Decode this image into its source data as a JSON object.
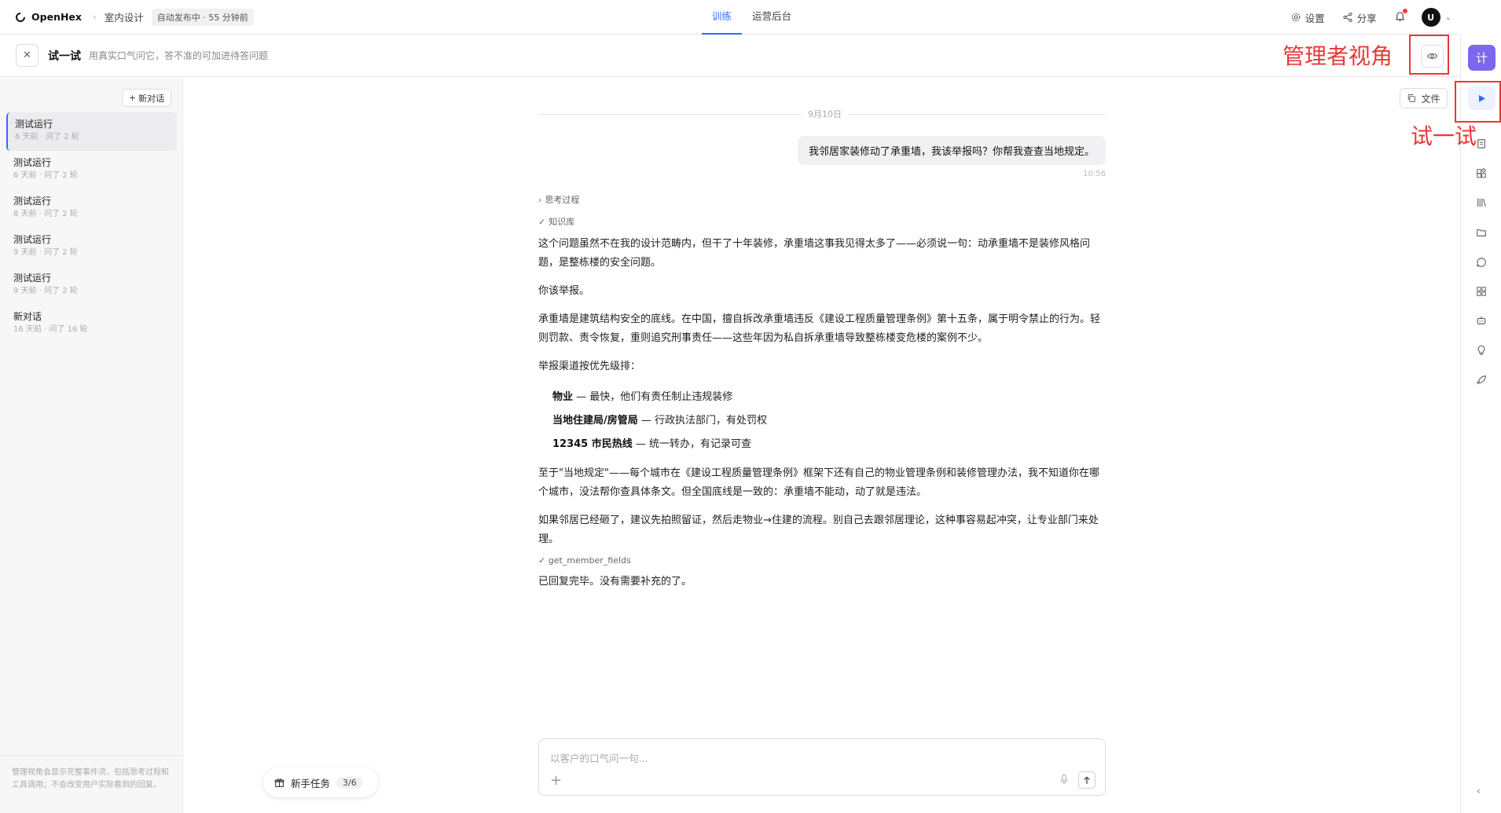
{
  "topbar": {
    "brand": "OpenHex",
    "crumb": "室内设计",
    "status": "自动发布中 · 55 分钟前",
    "tabs": [
      {
        "label": "训练",
        "active": true
      },
      {
        "label": "运营后台",
        "active": false
      }
    ],
    "settings_label": "设置",
    "share_label": "分享",
    "avatar_initial": "U"
  },
  "subbar": {
    "title": "试一试",
    "description": "用真实口气问它，答不准的可加进待答问题",
    "admin_annotation": "管理者视角"
  },
  "sidebar": {
    "new_chat_label": "新对话",
    "conversations": [
      {
        "title": "测试运行",
        "meta": "6 天前 · 问了 2 轮",
        "active": true
      },
      {
        "title": "测试运行",
        "meta": "6 天前 · 问了 2 轮",
        "active": false
      },
      {
        "title": "测试运行",
        "meta": "8 天前 · 问了 2 轮",
        "active": false
      },
      {
        "title": "测试运行",
        "meta": "9 天前 · 问了 2 轮",
        "active": false
      },
      {
        "title": "测试运行",
        "meta": "9 天前 · 问了 2 轮",
        "active": false
      },
      {
        "title": "新对话",
        "meta": "16 天前 · 问了 16 轮",
        "active": false
      }
    ],
    "footer_note": "管理视角会显示完整事件流，包括思考过程和工具调用；不会改变用户实际看到的回复。"
  },
  "chat": {
    "date": "9月10日",
    "user_message": "我邻居家装修动了承重墙，我该举报吗？你帮我查查当地规定。",
    "user_time": "10:56",
    "thinking_label": "思考过程",
    "kb_label": "知识库",
    "answer": {
      "p1": "这个问题虽然不在我的设计范畴内，但干了十年装修，承重墙这事我见得太多了——必须说一句：动承重墙不是装修风格问题，是整栋楼的安全问题。",
      "p2": "你该举报。",
      "p3": "承重墙是建筑结构安全的底线。在中国，擅自拆改承重墙违反《建设工程质量管理条例》第十五条，属于明令禁止的行为。轻则罚款、责令恢复，重则追究刑事责任——这些年因为私自拆承重墙导致整栋楼变危楼的案例不少。",
      "p4": "举报渠道按优先级排：",
      "channels": [
        {
          "name": "物业",
          "desc": " — 最快，他们有责任制止违规装修"
        },
        {
          "name": "当地住建局/房管局",
          "desc": " — 行政执法部门，有处罚权"
        },
        {
          "name": "12345 市民热线",
          "desc": " — 统一转办，有记录可查"
        }
      ],
      "p5": "至于\"当地规定\"——每个城市在《建设工程质量管理条例》框架下还有自己的物业管理条例和装修管理办法，我不知道你在哪个城市，没法帮你查具体条文。但全国底线是一致的：承重墙不能动，动了就是违法。",
      "p6": "如果邻居已经砸了，建议先拍照留证，然后走物业→住建的流程。别自己去跟邻居理论，这种事容易起冲突，让专业部门来处理。"
    },
    "tool_call": "get_member_fields",
    "final_message": "已回复完毕。没有需要补充的了。"
  },
  "files_label": "文件",
  "rail": {
    "brand_glyph": "计",
    "try_annotation": "试一试",
    "icons": [
      "play-icon",
      "document-icon",
      "widgets-icon",
      "library-icon",
      "folder-icon",
      "chat-icon",
      "grid-icon",
      "bot-icon",
      "bulb-icon",
      "rocket-icon"
    ]
  },
  "composer": {
    "placeholder": "以客户的口气问一句..."
  },
  "onboarding": {
    "label": "新手任务",
    "count": "3/6"
  },
  "colors": {
    "accent": "#2f6bff",
    "annotation": "#e53935",
    "brand_purple": "#7b68ee"
  }
}
